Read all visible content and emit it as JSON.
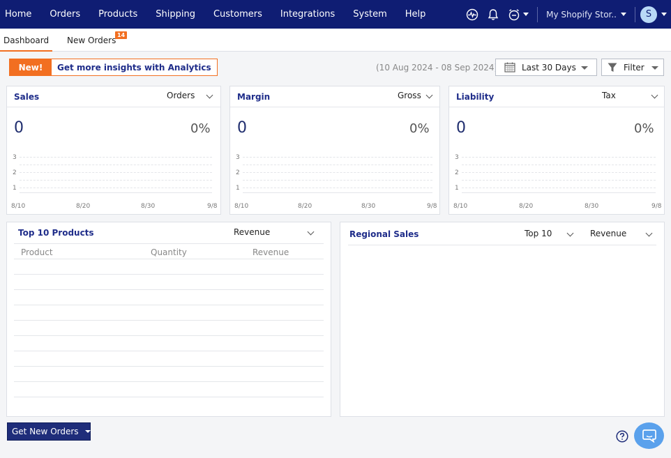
{
  "nav": {
    "items": [
      "Home",
      "Orders",
      "Products",
      "Shipping",
      "Customers",
      "Integrations",
      "System",
      "Help"
    ],
    "store_name": "My Shopify Stor..",
    "avatar_letter": "S"
  },
  "tabs": {
    "dashboard": "Dashboard",
    "new_orders": "New Orders",
    "new_orders_badge": "14"
  },
  "promo": {
    "new_label": "New!",
    "text": "Get more insights with Analytics"
  },
  "toolbar": {
    "date_range": "(10 Aug 2024 - 08 Sep 2024)",
    "period": "Last 30 Days",
    "filter": "Filter"
  },
  "cards": {
    "sales": {
      "title": "Sales",
      "metric": "Orders",
      "value": "0",
      "change": "0%"
    },
    "margin": {
      "title": "Margin",
      "metric": "Gross",
      "value": "0",
      "change": "0%"
    },
    "liability": {
      "title": "Liability",
      "metric": "Tax",
      "value": "0",
      "change": "0%"
    }
  },
  "chart": {
    "y_ticks": [
      "3",
      "2",
      "1"
    ],
    "x_ticks": [
      "8/10",
      "8/20",
      "8/30",
      "9/8"
    ]
  },
  "top_products": {
    "title": "Top 10 Products",
    "metric": "Revenue",
    "columns": [
      "Product",
      "Quantity",
      "Revenue"
    ]
  },
  "regional": {
    "title": "Regional Sales",
    "top_select": "Top 10",
    "metric": "Revenue"
  },
  "actions": {
    "get_new_orders": "Get New Orders"
  },
  "colors": {
    "nav_bg": "#0f1d73",
    "accent": "#f26f21",
    "title": "#1f2d8a"
  }
}
